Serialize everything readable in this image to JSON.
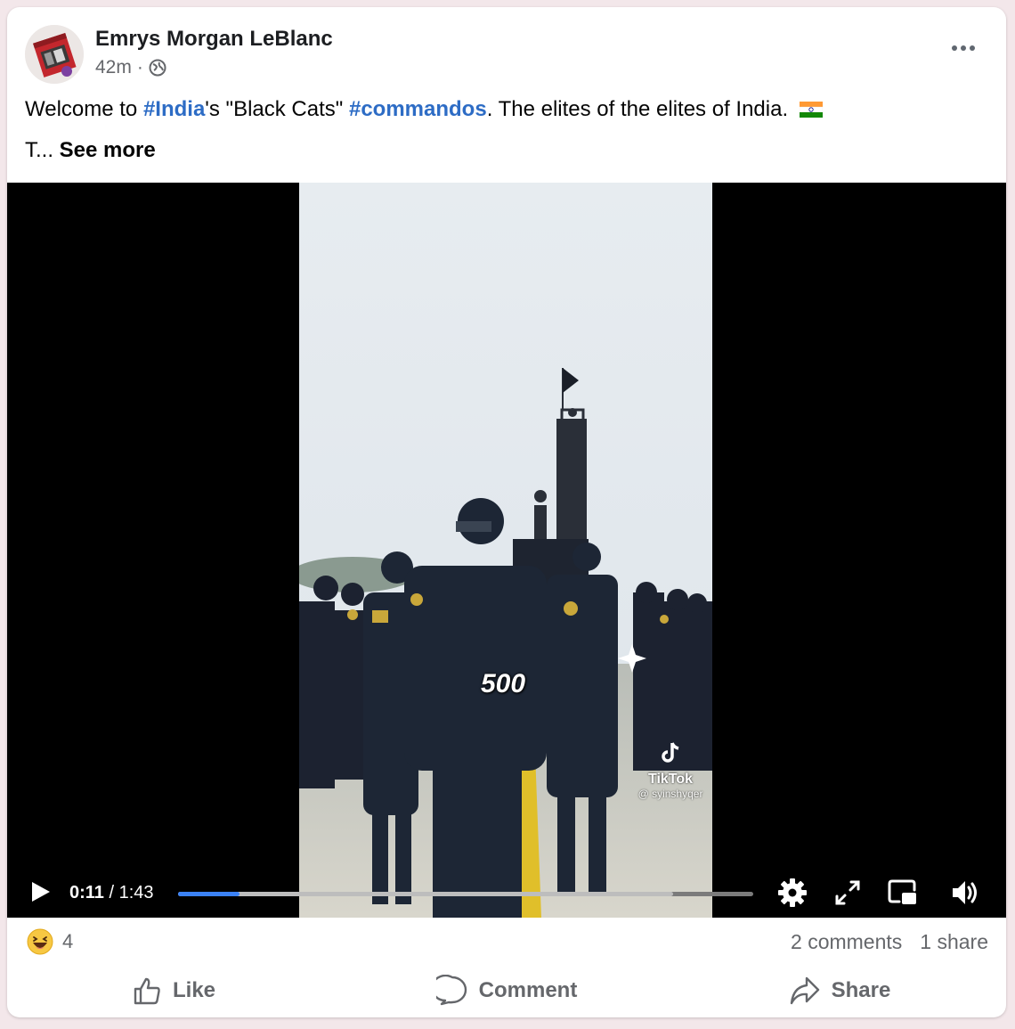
{
  "post": {
    "author": "Emrys Morgan LeBlanc",
    "timestamp": "42m",
    "separator": "·",
    "privacy_icon": "globe-icon",
    "text_parts": {
      "p1": "Welcome to ",
      "tag1": "#India",
      "p2": "'s \"Black Cats\" ",
      "tag2": "#commandos",
      "p3": ". The elites of the elites of India."
    },
    "truncated_text": "T... ",
    "see_more": "See more"
  },
  "video": {
    "overlay_text": "500",
    "watermark_brand": "TikTok",
    "watermark_handle": "@ syinshyqer",
    "current_time": "0:11",
    "time_separator": " / ",
    "duration": "1:43",
    "progress_fraction": 0.107,
    "buffered_fraction": 0.86,
    "icons": [
      "play-icon",
      "settings-gear-icon",
      "fullscreen-icon",
      "picture-in-picture-icon",
      "volume-icon"
    ]
  },
  "engagement": {
    "reaction_icon": "haha-emoji-icon",
    "reaction_count": "4",
    "comments": "2 comments",
    "shares": "1 share"
  },
  "actions": {
    "like": "Like",
    "comment": "Comment",
    "share": "Share"
  },
  "colors": {
    "hashtag": "#2d6cc5",
    "progress": "#3b82f6",
    "secondary_text": "#65676b"
  }
}
